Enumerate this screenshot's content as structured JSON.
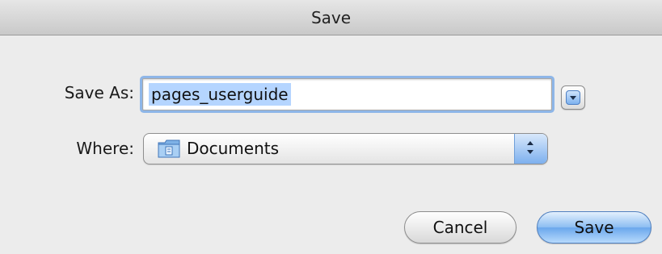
{
  "window": {
    "title": "Save"
  },
  "form": {
    "save_as_label": "Save As:",
    "save_as_value": "pages_userguide",
    "where_label": "Where:",
    "where_value": "Documents"
  },
  "buttons": {
    "cancel_label": "Cancel",
    "save_label": "Save"
  },
  "icons": {
    "expand": "chevron-down-icon",
    "folder": "folder-icon",
    "stepper": "up-down-arrows-icon"
  },
  "colors": {
    "selection": "#b5d5ff",
    "focus_ring": "#8eb6e8",
    "default_button": "#8cbdf2",
    "window_bg": "#ececec"
  }
}
